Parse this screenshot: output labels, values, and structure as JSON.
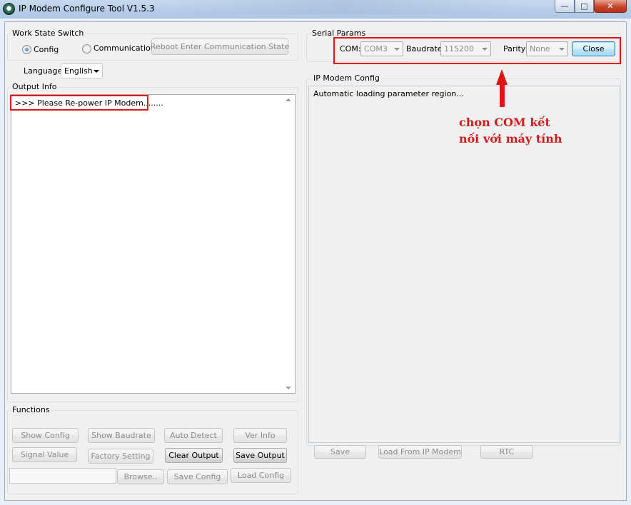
{
  "window": {
    "title": "IP Modem Configure Tool V1.5.3",
    "icon": "modem-app-icon",
    "controls": {
      "minimize": "—",
      "maximize": "□",
      "close": "✕"
    }
  },
  "work_state": {
    "group_label": "Work State Switch",
    "options": [
      {
        "label": "Config",
        "selected": true
      },
      {
        "label": "Communication",
        "selected": false
      }
    ],
    "reboot_button": "Reboot Enter Communication State"
  },
  "language": {
    "label": "Language",
    "value": "English"
  },
  "output_info": {
    "group_label": "Output Info",
    "lines": [
      ">>> Please Re-power IP Modem........"
    ]
  },
  "functions": {
    "group_label": "Functions",
    "buttons": {
      "show_config": "Show Config",
      "show_baudrate": "Show Baudrate",
      "auto_detect": "Auto Detect",
      "ver_info": "Ver Info",
      "signal_value": "Signal Value",
      "factory_setting": "Factory Setting",
      "clear_output": "Clear Output",
      "save_output": "Save Output",
      "browse": "Browse..",
      "save_config": "Save Config",
      "load_config": "Load Config"
    },
    "path_value": ""
  },
  "serial_params": {
    "group_label": "Serial Params",
    "com": {
      "label": "COM:",
      "value": "COM3"
    },
    "baudrate": {
      "label": "Baudrate:",
      "value": "115200"
    },
    "parity": {
      "label": "Parity:",
      "value": "None"
    },
    "close_button": "Close"
  },
  "ip_modem_config": {
    "group_label": "IP Modem Config",
    "text": "Automatic loading parameter region...",
    "buttons": {
      "save": "Save",
      "load_from_modem": "Load From IP Modem",
      "rtc": "RTC"
    }
  },
  "annotation": {
    "line1": "chọn COM kết",
    "line2": "nối với máy tính",
    "color": "#d71a1a"
  },
  "colors": {
    "highlight": "#e01414",
    "window_bg": "#f0f0f0"
  }
}
